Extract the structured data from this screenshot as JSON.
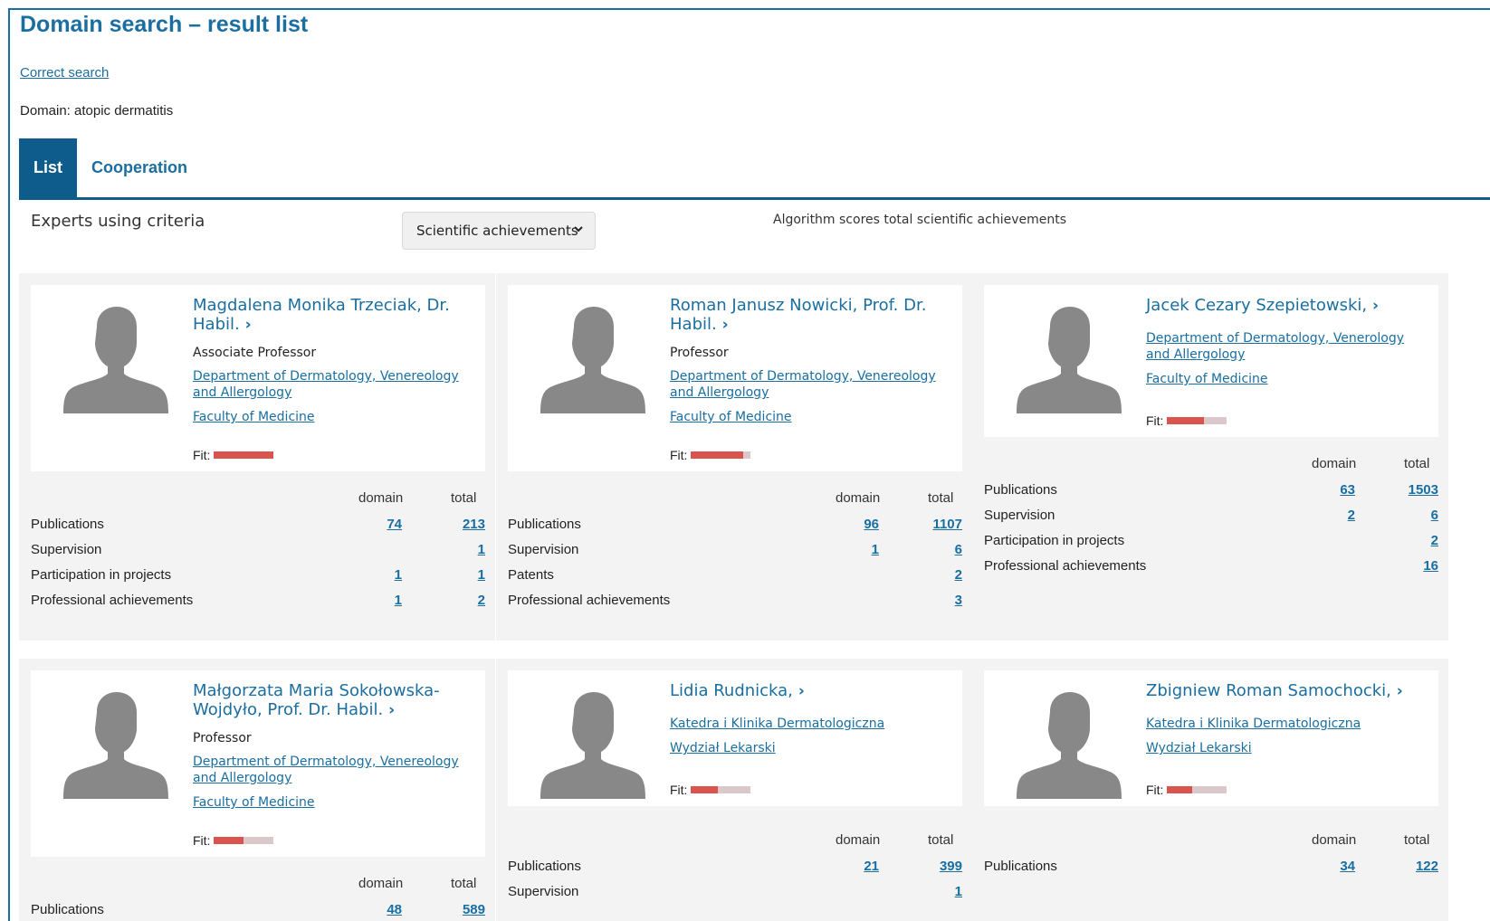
{
  "page_title": "Domain search – result list",
  "correct_search_label": "Correct search",
  "domain_line": "Domain: atopic dermatitis",
  "tabs": [
    {
      "label": "List",
      "active": true
    },
    {
      "label": "Cooperation",
      "active": false
    }
  ],
  "criteria_label": "Experts using criteria",
  "criteria_select": {
    "value": "Scientific achievements"
  },
  "algorithm_note": "Algorithm scores total scientific achievements",
  "column_headers": {
    "domain": "domain",
    "total": "total"
  },
  "fit_label": "Fit:",
  "colors": {
    "accent": "#1a6ea0",
    "tab_active": "#0e5c8c",
    "fit_fill": "#d9534f",
    "fit_track": "#dcc8cb",
    "card_bg": "#f3f3f3"
  },
  "experts": [
    {
      "name": "Magdalena Monika Trzeciak, Dr. Habil.",
      "position": "Associate Professor",
      "department": "Department of Dermatology, Venereology and Allergology",
      "faculty": "Faculty of Medicine",
      "fit": 1.0,
      "stats": [
        {
          "label": "Publications",
          "domain": "74",
          "total": "213"
        },
        {
          "label": "Supervision",
          "domain": "",
          "total": "1"
        },
        {
          "label": "Participation in projects",
          "domain": "1",
          "total": "1"
        },
        {
          "label": "Professional achievements",
          "domain": "1",
          "total": "2"
        }
      ]
    },
    {
      "name": "Roman Janusz Nowicki, Prof. Dr. Habil.",
      "position": "Professor",
      "department": "Department of Dermatology, Venereology and Allergology",
      "faculty": "Faculty of Medicine",
      "fit": 0.88,
      "stats": [
        {
          "label": "Publications",
          "domain": "96",
          "total": "1107"
        },
        {
          "label": "Supervision",
          "domain": "1",
          "total": "6"
        },
        {
          "label": "Patents",
          "domain": "",
          "total": "2"
        },
        {
          "label": "Professional achievements",
          "domain": "",
          "total": "3"
        }
      ]
    },
    {
      "name": "Jacek Cezary Szepietowski,",
      "position": "",
      "department": "Department of Dermatology, Venerology and Allergology",
      "faculty": "Faculty of Medicine",
      "fit": 0.62,
      "stats": [
        {
          "label": "Publications",
          "domain": "63",
          "total": "1503"
        },
        {
          "label": "Supervision",
          "domain": "2",
          "total": "6"
        },
        {
          "label": "Participation in projects",
          "domain": "",
          "total": "2"
        },
        {
          "label": "Professional achievements",
          "domain": "",
          "total": "16"
        }
      ]
    },
    {
      "name": "Małgorzata Maria Sokołowska-Wojdyło, Prof. Dr. Habil.",
      "position": "Professor",
      "department": "Department of Dermatology, Venereology and Allergology",
      "faculty": "Faculty of Medicine",
      "fit": 0.5,
      "stats": [
        {
          "label": "Publications",
          "domain": "48",
          "total": "589"
        }
      ]
    },
    {
      "name": "Lidia Rudnicka,",
      "position": "",
      "department": "Katedra i Klinika Dermatologiczna",
      "faculty": "Wydział Lekarski",
      "fit": 0.45,
      "stats": [
        {
          "label": "Publications",
          "domain": "21",
          "total": "399"
        },
        {
          "label": "Supervision",
          "domain": "",
          "total": "1"
        }
      ]
    },
    {
      "name": "Zbigniew Roman Samochocki,",
      "position": "",
      "department": "Katedra i Klinika Dermatologiczna",
      "faculty": "Wydział Lekarski",
      "fit": 0.42,
      "stats": [
        {
          "label": "Publications",
          "domain": "34",
          "total": "122"
        }
      ]
    }
  ]
}
